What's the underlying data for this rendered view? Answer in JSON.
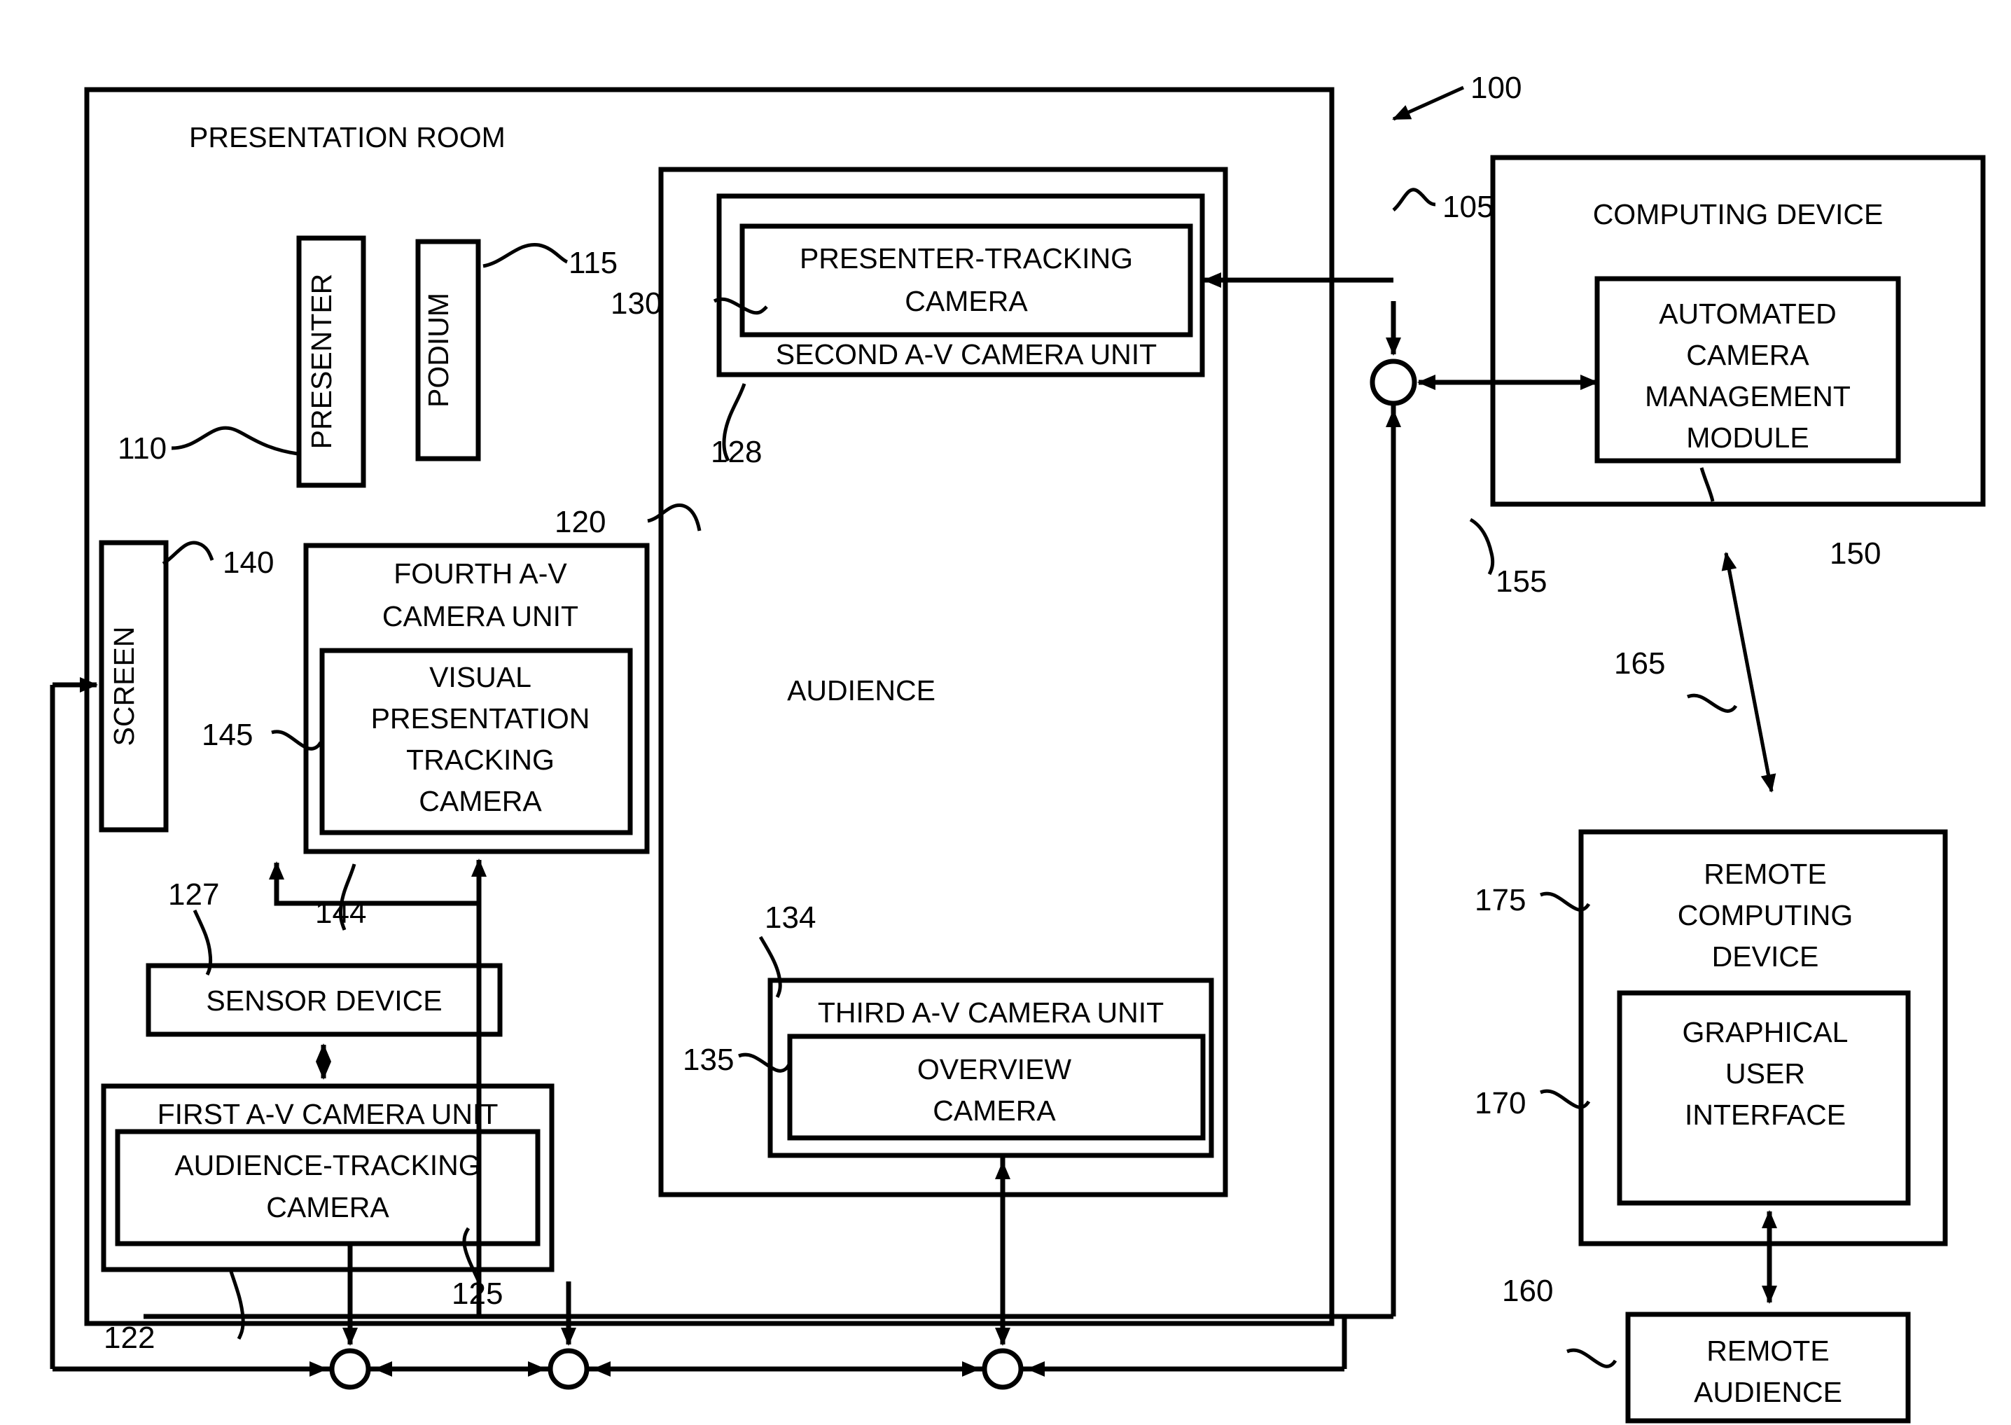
{
  "figure": {
    "title": "Automated camera management system block diagram",
    "system_ref": "100"
  },
  "room": {
    "label": "PRESENTATION ROOM",
    "ref": "105"
  },
  "boxes": {
    "presenter": {
      "label": "PRESENTER",
      "ref": "110"
    },
    "podium": {
      "label": "PODIUM",
      "ref": "115"
    },
    "audience": {
      "label": "AUDIENCE",
      "ref": "120"
    },
    "screen": {
      "label": "SCREEN",
      "ref": "140"
    },
    "sensor_device": {
      "label": "SENSOR DEVICE",
      "ref": "127"
    },
    "first_av_unit": {
      "label": "FIRST A-V CAMERA UNIT",
      "ref": "122"
    },
    "audience_tracking_camera": {
      "label": "AUDIENCE-TRACKING CAMERA",
      "line1": "AUDIENCE-TRACKING",
      "line2": "CAMERA",
      "ref": "125"
    },
    "second_av_unit": {
      "label": "SECOND A-V CAMERA UNIT",
      "ref": "128"
    },
    "presenter_tracking_camera": {
      "label": "PRESENTER-TRACKING CAMERA",
      "line1": "PRESENTER-TRACKING",
      "line2": "CAMERA",
      "ref": "130"
    },
    "third_av_unit": {
      "label": "THIRD A-V CAMERA UNIT",
      "ref": "134"
    },
    "overview_camera": {
      "label": "OVERVIEW CAMERA",
      "line1": "OVERVIEW",
      "line2": "CAMERA",
      "ref": "135"
    },
    "fourth_av_unit": {
      "label": "FOURTH A-V CAMERA UNIT",
      "line1": "FOURTH A-V",
      "line2": "CAMERA UNIT",
      "ref": "144"
    },
    "visual_presentation_tracking_camera": {
      "label": "VISUAL PRESENTATION TRACKING CAMERA",
      "line1": "VISUAL",
      "line2": "PRESENTATION",
      "line3": "TRACKING",
      "line4": "CAMERA",
      "ref": "145"
    },
    "computing_device": {
      "label": "COMPUTING DEVICE",
      "ref": "155"
    },
    "automated_camera_management_module": {
      "label": "AUTOMATED CAMERA MANAGEMENT MODULE",
      "line1": "AUTOMATED",
      "line2": "CAMERA",
      "line3": "MANAGEMENT",
      "line4": "MODULE",
      "ref": "150"
    },
    "remote_computing_device": {
      "label": "REMOTE COMPUTING DEVICE",
      "line1": "REMOTE",
      "line2": "COMPUTING",
      "line3": "DEVICE",
      "ref": "175"
    },
    "graphical_user_interface": {
      "label": "GRAPHICAL USER INTERFACE",
      "line1": "GRAPHICAL",
      "line2": "USER",
      "line3": "INTERFACE",
      "ref": "170"
    },
    "remote_audience": {
      "label": "REMOTE AUDIENCE",
      "line1": "REMOTE",
      "line2": "AUDIENCE",
      "ref": "160"
    }
  },
  "connections": {
    "network_link_ref": "165"
  },
  "reference_numerals": [
    "100",
    "105",
    "110",
    "115",
    "120",
    "122",
    "125",
    "127",
    "128",
    "130",
    "134",
    "135",
    "140",
    "144",
    "145",
    "150",
    "155",
    "160",
    "165",
    "170",
    "175"
  ],
  "colors": {
    "line": "#000000",
    "background": "#ffffff"
  }
}
